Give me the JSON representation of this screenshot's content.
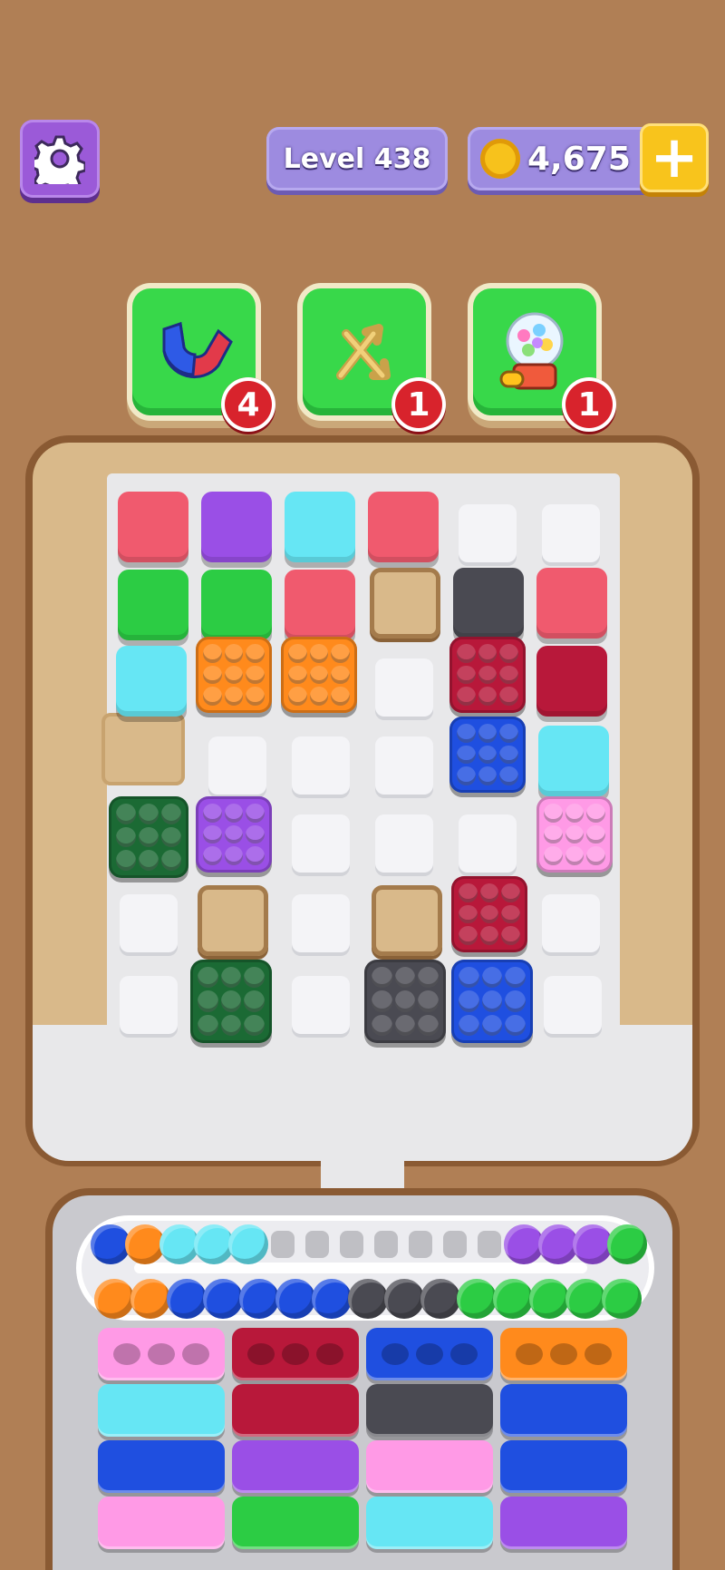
{
  "header": {
    "level_label": "Level 438",
    "coins": "4,675",
    "plus_label": "+"
  },
  "boosters": [
    {
      "name": "magnet",
      "count": "4"
    },
    {
      "name": "shuffle",
      "count": "1"
    },
    {
      "name": "gumball",
      "count": "1"
    }
  ],
  "colors": {
    "red": "#f05a6e",
    "purple": "#9a4fe6",
    "cyan": "#66e6f4",
    "green": "#2ccc44",
    "dark_gray": "#4a4a52",
    "tan": "#d9b98a",
    "orange": "#ff8a1c",
    "crimson": "#b8183a",
    "blue": "#1f4fe0",
    "dark_green": "#1b6a34",
    "pink": "#ff9ae6"
  },
  "conveyor": {
    "top_row": [
      "blue",
      "orange",
      "cyan",
      "cyan",
      "cyan",
      "empty",
      "empty",
      "empty",
      "empty",
      "empty",
      "empty",
      "empty",
      "purple",
      "purple",
      "purple",
      "green"
    ],
    "bottom_row": [
      "orange",
      "orange",
      "blue",
      "blue",
      "blue",
      "blue",
      "blue",
      "dark_gray",
      "dark_gray",
      "dark_gray",
      "green",
      "green",
      "green",
      "green",
      "green"
    ]
  },
  "trays": [
    [
      "pink",
      "cyan",
      "blue",
      "pink"
    ],
    [
      "crimson",
      "crimson",
      "purple",
      "green"
    ],
    [
      "blue",
      "dark_gray",
      "pink",
      "cyan"
    ],
    [
      "orange",
      "blue",
      "blue",
      "purple"
    ]
  ]
}
